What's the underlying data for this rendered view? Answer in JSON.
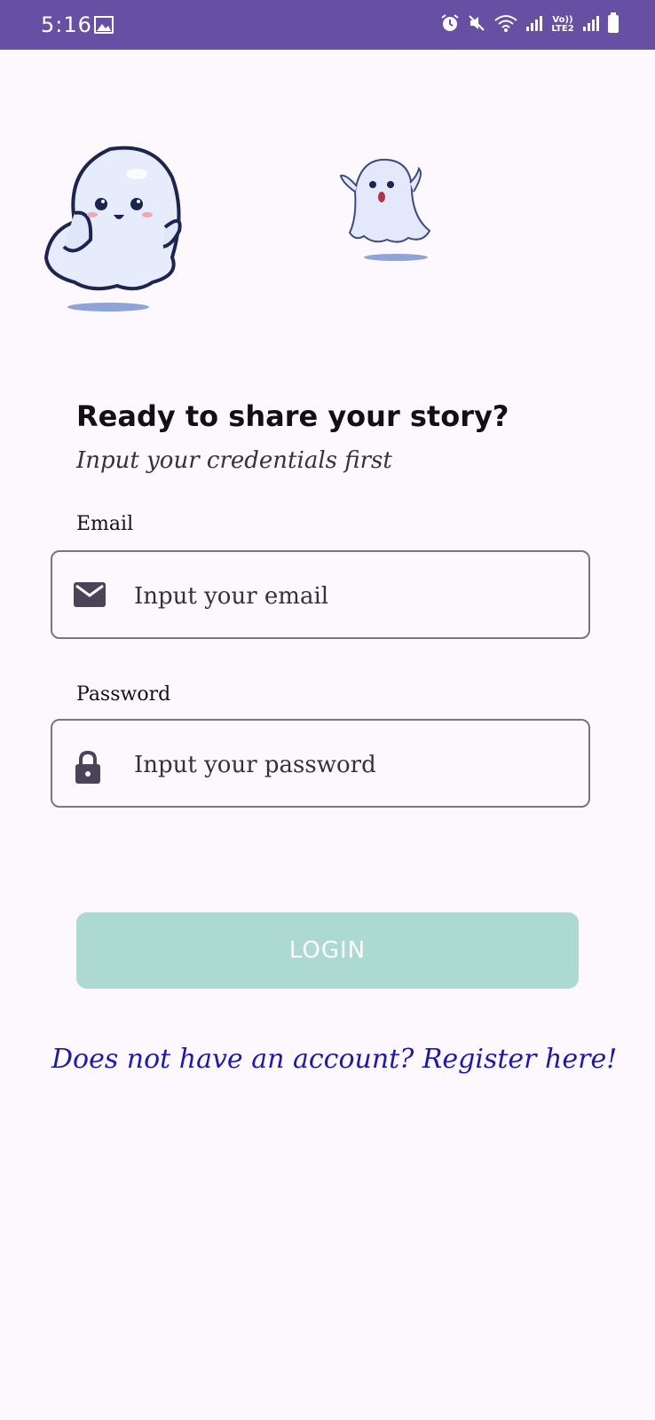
{
  "status_bar": {
    "time": "5:16",
    "network_label": "Vo)) LTE2",
    "icons": [
      "image-icon",
      "alarm-icon",
      "mute-icon",
      "wifi-icon",
      "signal-icon",
      "battery-icon"
    ]
  },
  "header": {
    "title": "Ready to share your story?",
    "subtitle": "Input your credentials first"
  },
  "form": {
    "email_label": "Email",
    "email_placeholder": "Input your email",
    "email_value": "",
    "password_label": "Password",
    "password_placeholder": "Input your password",
    "password_value": ""
  },
  "actions": {
    "login_label": "LOGIN",
    "register_link": "Does not have an account? Register here!"
  },
  "colors": {
    "status_bar": "#6750a4",
    "background": "#fdf8fd",
    "login_button": "#acd9d2",
    "link": "#1d1aa8"
  }
}
